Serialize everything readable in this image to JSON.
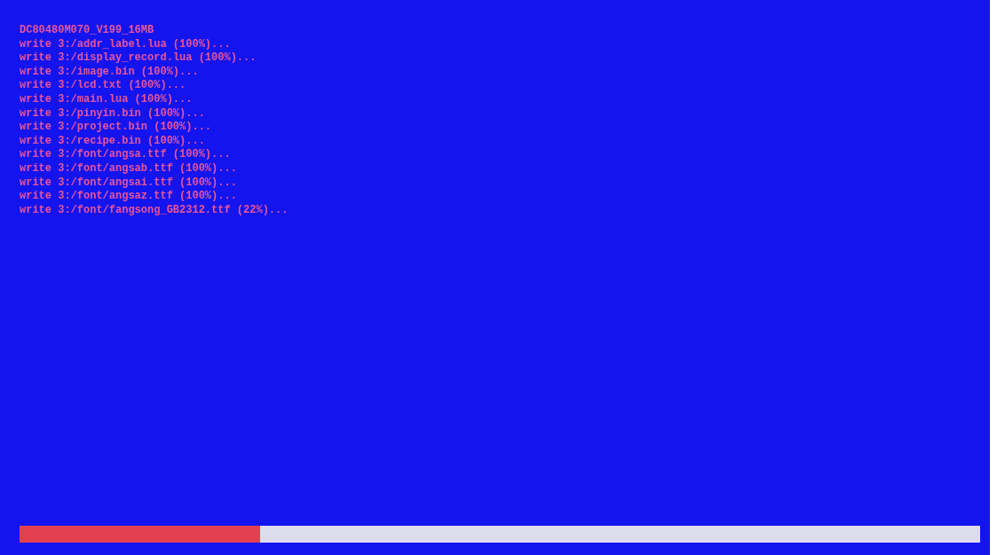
{
  "log_lines": [
    "DC80480M070_V199_16MB",
    "write 3:/addr_label.lua (100%)...",
    "write 3:/display_record.lua (100%)...",
    "write 3:/image.bin (100%)...",
    "write 3:/lcd.txt (100%)...",
    "write 3:/main.lua (100%)...",
    "write 3:/pinyin.bin (100%)...",
    "write 3:/project.bin (100%)...",
    "write 3:/recipe.bin (100%)...",
    "write 3:/font/angsa.ttf (100%)...",
    "write 3:/font/angsab.ttf (100%)...",
    "write 3:/font/angsai.ttf (100%)...",
    "write 3:/font/angsaz.ttf (100%)...",
    "write 3:/font/fangsong_GB2312.ttf (22%)..."
  ],
  "progress": {
    "level": 0.25
  }
}
